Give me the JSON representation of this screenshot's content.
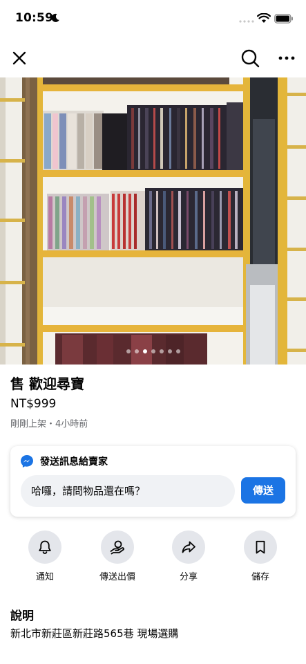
{
  "status_bar": {
    "time": "10:59"
  },
  "nav": {
    "close_icon": "close-icon",
    "search_icon": "search-icon",
    "more_icon": "more-icon"
  },
  "gallery": {
    "photo_count": 7,
    "active_index": 2
  },
  "listing": {
    "title": "售 歡迎尋寶",
    "price": "NT$999",
    "meta": "剛剛上架・4小時前"
  },
  "message": {
    "header": "發送訊息給賣家",
    "input_value": "哈囉，請問物品還在嗎？",
    "send_label": "傳送",
    "brand_color": "#1b74e4"
  },
  "actions": [
    {
      "label": "通知",
      "icon": "bell-icon"
    },
    {
      "label": "傳送出價",
      "icon": "offer-icon"
    },
    {
      "label": "分享",
      "icon": "share-icon"
    },
    {
      "label": "儲存",
      "icon": "bookmark-icon"
    }
  ],
  "description": {
    "heading": "說明",
    "text": "新北市新莊區新莊路565巷 現場選購"
  }
}
